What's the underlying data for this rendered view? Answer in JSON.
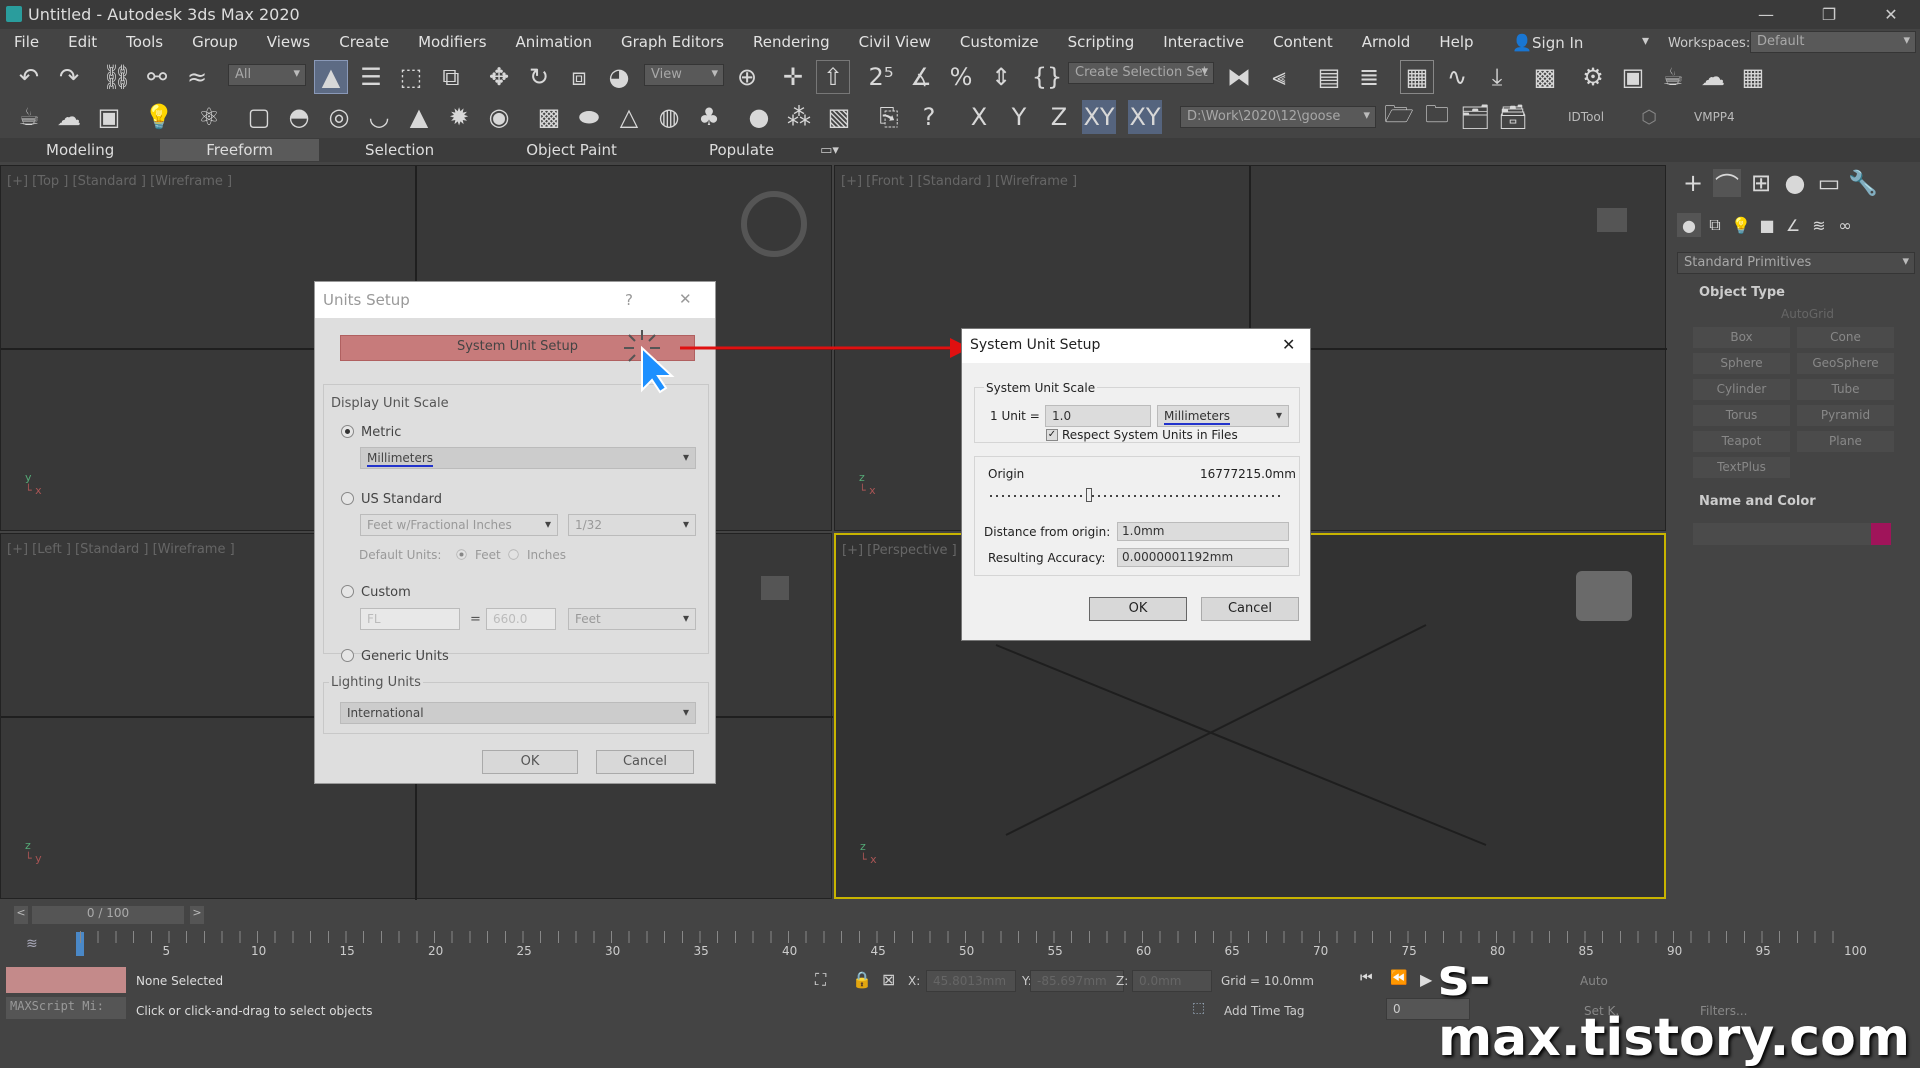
{
  "window": {
    "title": "Untitled - Autodesk 3ds Max 2020",
    "minimize": "—",
    "restore": "❐",
    "close": "✕"
  },
  "menu": [
    "File",
    "Edit",
    "Tools",
    "Group",
    "Views",
    "Create",
    "Modifiers",
    "Animation",
    "Graph Editors",
    "Rendering",
    "Civil View",
    "Customize",
    "Scripting",
    "Interactive",
    "Content",
    "Arnold",
    "Help"
  ],
  "account": {
    "sign_in": "Sign In",
    "workspaces_label": "Workspaces:",
    "workspace": "Default"
  },
  "toolbar1": {
    "filter": "All",
    "view": "View",
    "selection_set": "Create Selection Set"
  },
  "toolbar2": {
    "axis_x": "X",
    "axis_y": "Y",
    "axis_z": "Z",
    "axis_xy": "XY",
    "axis_xy2": "XY",
    "project_path": "D:\\Work\\2020\\12\\goose",
    "idtool": "IDTool",
    "vmpp4": "VMPP4"
  },
  "ribbon": [
    "Modeling",
    "Freeform",
    "Selection",
    "Object Paint",
    "Populate"
  ],
  "viewports": {
    "top": "[+] [Top ] [Standard ] [Wireframe ]",
    "front": "[+] [Front ] [Standard ] [Wireframe ]",
    "left": "[+] [Left ] [Standard ] [Wireframe ]",
    "persp": "[+] [Perspective ] [Standard ] [Default Shading ]"
  },
  "units_setup": {
    "title": "Units Setup",
    "help": "?",
    "close": "✕",
    "system_btn": "System Unit Setup",
    "display_scale": "Display Unit Scale",
    "metric": "Metric",
    "metric_unit": "Millimeters",
    "us_standard": "US Standard",
    "us_unit": "Feet w/Fractional Inches",
    "us_frac": "1/32",
    "default_units": "Default Units:",
    "feet": "Feet",
    "inches": "Inches",
    "custom": "Custom",
    "custom_name": "FL",
    "equals": "=",
    "custom_value": "660.0",
    "custom_unit": "Feet",
    "generic": "Generic Units",
    "lighting": "Lighting Units",
    "lighting_value": "International",
    "ok": "OK",
    "cancel": "Cancel"
  },
  "sys_unit": {
    "title": "System Unit Setup",
    "close": "✕",
    "scale_group": "System Unit Scale",
    "one_unit": "1 Unit =",
    "value": "1.0",
    "unit": "Millimeters",
    "respect": "Respect System Units in Files",
    "origin_label": "Origin",
    "origin_value": "16777215.0mm",
    "distance_label": "Distance from origin:",
    "distance_value": "1.0mm",
    "accuracy_label": "Resulting Accuracy:",
    "accuracy_value": "0.0000001192mm",
    "ok": "OK",
    "cancel": "Cancel"
  },
  "command_panel": {
    "category": "Standard Primitives",
    "object_type": "Object Type",
    "autogrid": "AutoGrid",
    "buttons": [
      "Box",
      "Cone",
      "Sphere",
      "GeoSphere",
      "Cylinder",
      "Tube",
      "Torus",
      "Pyramid",
      "Teapot",
      "Plane",
      "TextPlus"
    ],
    "name_color": "Name and Color",
    "swatch_color": "#a0145a"
  },
  "timeline": {
    "frame": "0 / 100",
    "prev": "<",
    "next": ">",
    "ticks": [
      "5",
      "10",
      "15",
      "20",
      "25",
      "30",
      "35",
      "40",
      "45",
      "50",
      "55",
      "60",
      "65",
      "70",
      "75",
      "80",
      "85",
      "90",
      "95",
      "100"
    ]
  },
  "status": {
    "maxscript": "MAXScript Mi:",
    "none_selected": "None Selected",
    "prompt": "Click or click-and-drag to select objects",
    "x_label": "X:",
    "x_value": "45.8013mm",
    "y_label": "Y:",
    "y_value": "-85.697mm",
    "z_label": "Z:",
    "z_value": "0.0mm",
    "grid": "Grid = 10.0mm",
    "add_time_tag": "Add Time Tag",
    "frame_field": "0",
    "auto": "Auto",
    "set_k": "Set K.",
    "filters": "Filters..."
  },
  "watermark": "s-max.tistory.com",
  "colors": {
    "highlight_btn": "#c77b7b",
    "arrow": "#e01010",
    "cursor": "#1e90ff",
    "underline": "#2233cc",
    "active_vp": "#c8b400"
  }
}
